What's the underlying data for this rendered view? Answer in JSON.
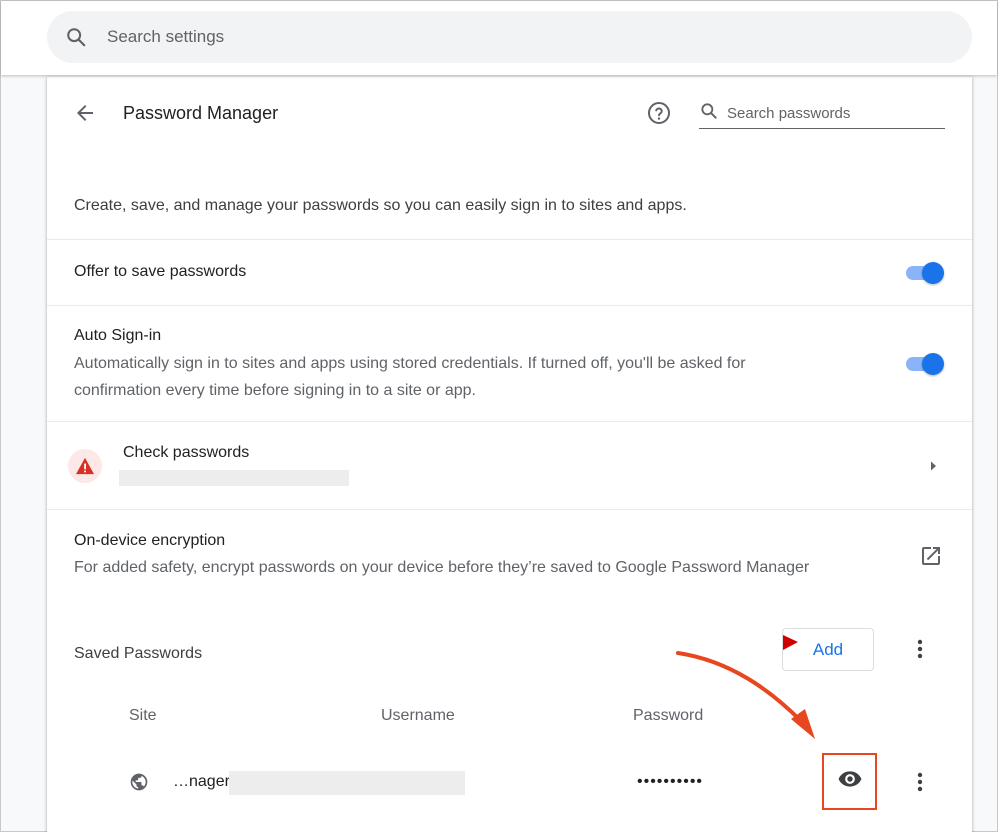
{
  "search": {
    "placeholder": "Search settings"
  },
  "header": {
    "title": "Password Manager",
    "search_placeholder": "Search passwords"
  },
  "description": "Create, save, and manage your passwords so you can easily sign in to sites and apps.",
  "offer_to_save": {
    "label": "Offer to save passwords",
    "enabled": true
  },
  "auto_signin": {
    "title": "Auto Sign-in",
    "line1": "Automatically sign in to sites and apps using stored credentials. If turned off, you'll be asked for",
    "line2": "confirmation every time before signing in to a site or app.",
    "enabled": true
  },
  "check_passwords": {
    "title": "Check passwords"
  },
  "encryption": {
    "title": "On-device encryption",
    "description": "For added safety, encrypt passwords on your device before they’re saved to Google Password Manager"
  },
  "saved_passwords": {
    "title": "Saved Passwords",
    "add_label": "Add",
    "columns": {
      "site": "Site",
      "username": "Username",
      "password": "Password"
    },
    "rows": [
      {
        "site": "…nager",
        "password": "••••••••••"
      }
    ]
  },
  "colors": {
    "accent": "#1a73e8",
    "annotation": "#e8461f",
    "warning": "#d93025"
  }
}
